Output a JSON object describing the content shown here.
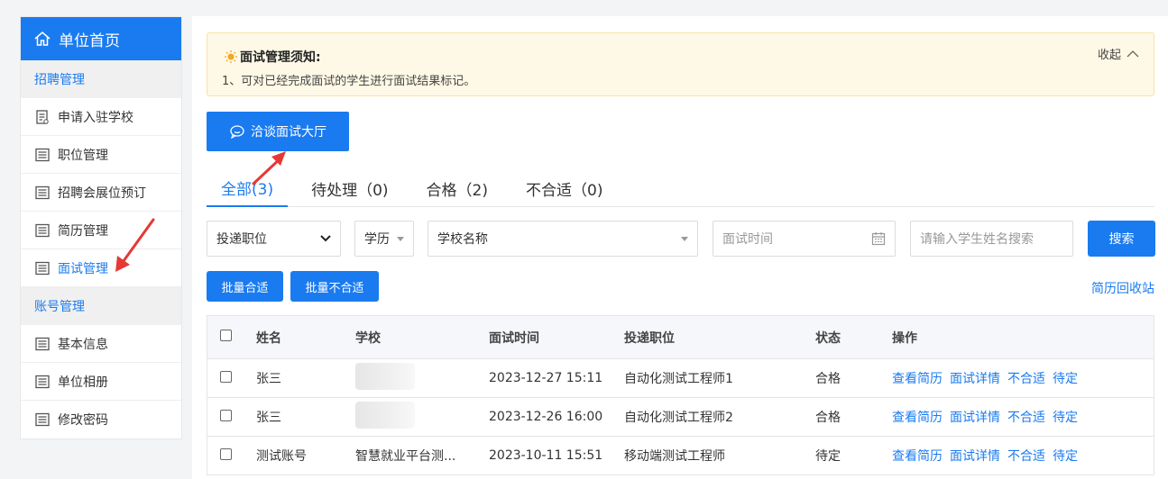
{
  "sidebar": {
    "home": "单位首页",
    "section1": "招聘管理",
    "items1": [
      "申请入驻学校",
      "职位管理",
      "招聘会展位预订",
      "简历管理",
      "面试管理"
    ],
    "section2": "账号管理",
    "items2": [
      "基本信息",
      "单位相册",
      "修改密码"
    ]
  },
  "notice": {
    "title": "面试管理须知:",
    "text": "1、可对已经完成面试的学生进行面试结果标记。",
    "collapse": "收起"
  },
  "hall_button": "洽谈面试大厅",
  "tabs": [
    "全部(3)",
    "待处理（0)",
    "合格（2)",
    "不合适（0)"
  ],
  "filters": {
    "position": "投递职位",
    "education": "学历",
    "school": "学校名称",
    "time_placeholder": "面试时间",
    "name_placeholder": "请输入学生姓名搜索",
    "search": "搜索"
  },
  "batch": {
    "pass": "批量合适",
    "fail": "批量不合适",
    "recycle": "简历回收站"
  },
  "table": {
    "headers": [
      "姓名",
      "学校",
      "面试时间",
      "投递职位",
      "状态",
      "操作"
    ],
    "rows": [
      {
        "name": "张三",
        "school": "",
        "time": "2023-12-27 15:11",
        "position": "自动化测试工程师1",
        "status": "合格"
      },
      {
        "name": "张三",
        "school": "",
        "time": "2023-12-26 16:00",
        "position": "自动化测试工程师2",
        "status": "合格"
      },
      {
        "name": "测试账号",
        "school": "智慧就业平台测...",
        "time": "2023-10-11 15:51",
        "position": "移动端测试工程师",
        "status": "待定"
      }
    ],
    "actions": [
      "查看简历",
      "面试详情",
      "不合适",
      "待定"
    ]
  },
  "colors": {
    "accent": "#1a7bf0",
    "notice_bg": "#fef9e6",
    "arrow": "#e53935"
  }
}
